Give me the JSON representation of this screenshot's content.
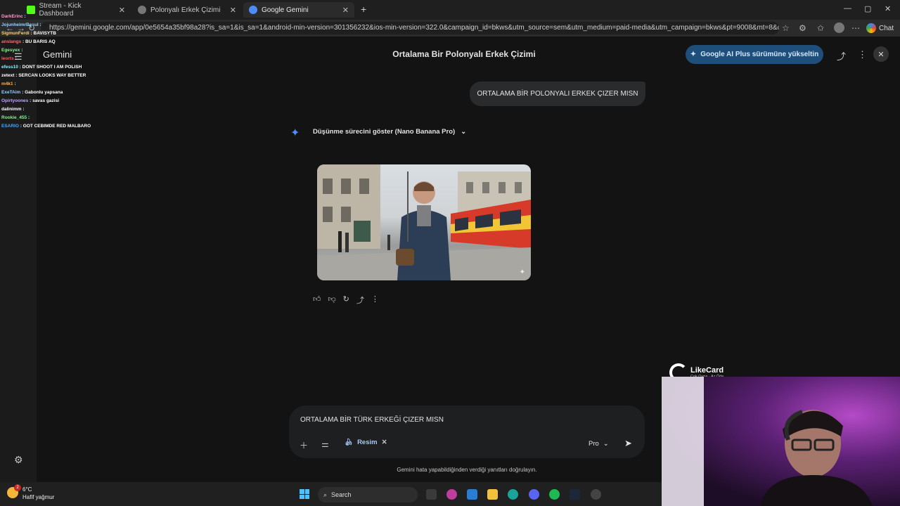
{
  "browser": {
    "tabs": [
      {
        "label": "Stream - Kick Dashboard",
        "active": false
      },
      {
        "label": "Polonyalı Erkek Çizimi",
        "active": false
      },
      {
        "label": "Google Gemini",
        "active": true
      }
    ],
    "new_tab": "+",
    "url": "https://gemini.google.com/app/0e5654a35bf98a28?is_sa=1&is_sa=1&android-min-version=301356232&ios-min-version=322.0&campaign_id=bkws&utm_source=sem&utm_medium=paid-media&utm_campaign=bkws&pt=9008&mt=8&ct=p-gro...",
    "chat_button": "Chat"
  },
  "stream_chat": [
    {
      "user": "DarkErinc",
      "msg": ":",
      "color": "#ff9ad5"
    },
    {
      "user": "JojunheimrBesul",
      "msg": ":",
      "color": "#9ad0ff"
    },
    {
      "user": "SigmunFerdi",
      "msg": ": BAVISYTB",
      "color": "#ffd27a"
    },
    {
      "user": "anslangs",
      "msg": ": BU BARIS AQ",
      "color": "#ff6b6b"
    },
    {
      "user": "Egesyex",
      "msg": ":",
      "color": "#8ef08e"
    },
    {
      "user": "leorts",
      "msg": ":",
      "color": "#ff5a5a"
    },
    {
      "user": "efess10",
      "msg": ": DONT SHOOT I AM POLISH",
      "color": "#8ef0ff"
    },
    {
      "user": "zetext",
      "msg": ": SERCAN LOOKS WAY BETTER",
      "color": "#ffffff"
    },
    {
      "user": "m4k1",
      "msg": ":",
      "color": "#ffb347"
    },
    {
      "user": "ExeTAim",
      "msg": ": Gabonlu yapsana",
      "color": "#9ad0ff"
    },
    {
      "user": "Opirtyoones",
      "msg": ": savas gazisi",
      "color": "#c2a2ff"
    },
    {
      "user": "dalinimm",
      "msg": ":",
      "color": "#ffffff"
    },
    {
      "user": "Rookie_455",
      "msg": ":",
      "color": "#8ef08e"
    },
    {
      "user": "ESARIO",
      "msg": ": GOT CEBIMDE RED MALBARO",
      "color": "#4aa8ff"
    }
  ],
  "app": {
    "brand": "Gemini",
    "conversation_title": "Ortalama Bir Polonyalı Erkek Çizimi",
    "upgrade_label": "Google AI Plus sürümüne yükseltin"
  },
  "conversation": {
    "user_message": "ORTALAMA BİR POLONYALI ERKEK ÇIZER MISN",
    "thinking_label": "Düşünme sürecini göster (Nano Banana Pro)"
  },
  "composer": {
    "value": "ORTALAMA BİR TÜRK ERKEĞİ ÇIZER MISN",
    "chip_label": "Resim",
    "model_label": "Pro",
    "disclaimer": "Gemini hata yapabildiğinden verdiği yanıtları doğrulayın."
  },
  "overlay": {
    "logo_name": "LikeCard",
    "logo_tag": "Çok Oyna · Az Öde"
  },
  "taskbar": {
    "temperature": "6°C",
    "weather": "Hafif yağmur",
    "search_placeholder": "Search",
    "notification_badge": "2"
  },
  "colors": {
    "background": "#131314",
    "upgrade_button": "#1d4f7a",
    "accent": "#4c8df6"
  }
}
